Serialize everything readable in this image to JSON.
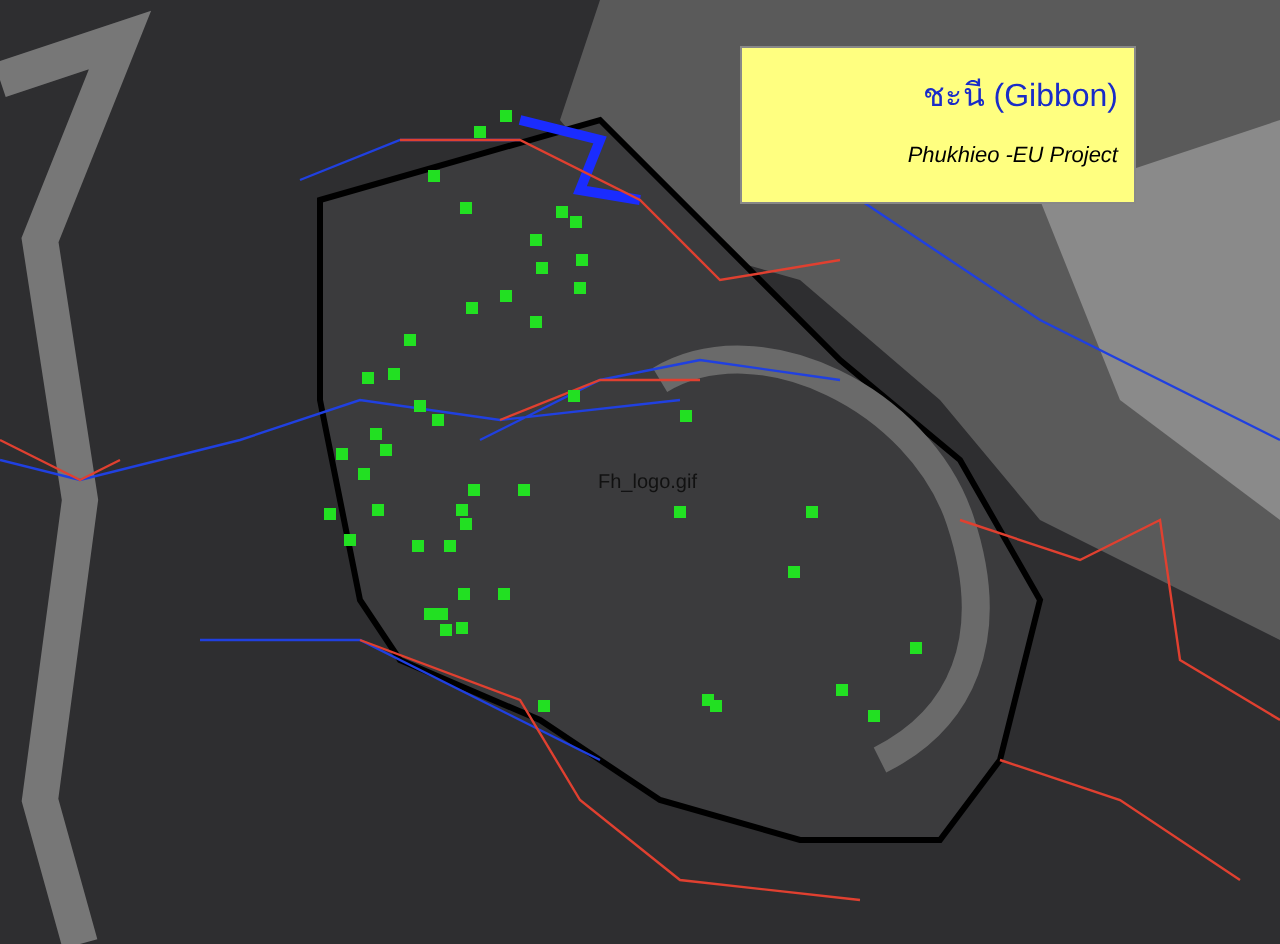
{
  "legend": {
    "title": "ชะนี (Gibbon)",
    "subtitle": "Phukhieo -EU Project"
  },
  "map": {
    "label": "Fh_logo.gif"
  }
}
